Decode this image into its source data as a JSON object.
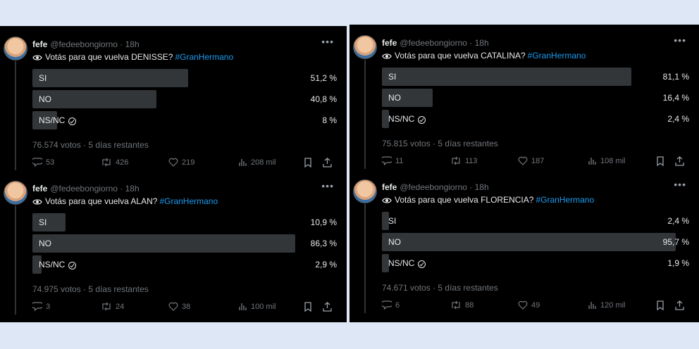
{
  "tweets": [
    {
      "user": {
        "name": "fefe",
        "handle": "@fedeebongiorno",
        "time": "18h"
      },
      "question": "Votás para que vuelva DENISSE?",
      "hashtag": "#GranHermano",
      "options": [
        {
          "label": "SI",
          "percent_text": "51,2 %",
          "percent": 51.2
        },
        {
          "label": "NO",
          "percent_text": "40,8 %",
          "percent": 40.8
        },
        {
          "label": "NS/NC",
          "percent_text": "8 %",
          "percent": 8,
          "selected": true
        }
      ],
      "votes_info": "76.574 votos · 5 días restantes",
      "stats": {
        "replies": "53",
        "retweets": "426",
        "likes": "219",
        "views": "208 mil"
      }
    },
    {
      "user": {
        "name": "fefe",
        "handle": "@fedeebongiorno",
        "time": "18h"
      },
      "question": "Votás para que vuelva ALAN?",
      "hashtag": "#GranHermano",
      "options": [
        {
          "label": "SI",
          "percent_text": "10,9 %",
          "percent": 10.9
        },
        {
          "label": "NO",
          "percent_text": "86,3 %",
          "percent": 86.3
        },
        {
          "label": "NS/NC",
          "percent_text": "2,9 %",
          "percent": 2.9,
          "selected": true
        }
      ],
      "votes_info": "74.975 votos · 5 días restantes",
      "stats": {
        "replies": "3",
        "retweets": "24",
        "likes": "38",
        "views": "100 mil"
      }
    },
    {
      "user": {
        "name": "fefe",
        "handle": "@fedeebongiorno",
        "time": "18h"
      },
      "question": "Votás para que vuelva CATALINA?",
      "hashtag": "#GranHermano",
      "options": [
        {
          "label": "SI",
          "percent_text": "81,1 %",
          "percent": 81.1
        },
        {
          "label": "NO",
          "percent_text": "16,4 %",
          "percent": 16.4
        },
        {
          "label": "NS/NC",
          "percent_text": "2,4 %",
          "percent": 2.4,
          "selected": true
        }
      ],
      "votes_info": "75.815 votos · 5 días restantes",
      "stats": {
        "replies": "11",
        "retweets": "113",
        "likes": "187",
        "views": "108 mil"
      }
    },
    {
      "user": {
        "name": "fefe",
        "handle": "@fedeebongiorno",
        "time": "18h"
      },
      "question": "Votás para que vuelva FLORENCIA?",
      "hashtag": "#GranHermano",
      "options": [
        {
          "label": "SI",
          "percent_text": "2,4 %",
          "percent": 2.4
        },
        {
          "label": "NO",
          "percent_text": "95,7 %",
          "percent": 95.7
        },
        {
          "label": "NS/NC",
          "percent_text": "1,9 %",
          "percent": 1.9,
          "selected": true
        }
      ],
      "votes_info": "74.671 votos · 5 días restantes",
      "stats": {
        "replies": "6",
        "retweets": "88",
        "likes": "49",
        "views": "120 mil"
      }
    }
  ],
  "colors": {
    "background": "#000000",
    "bar": "#333639",
    "text": "#e7e9ea",
    "muted": "#71767b",
    "accent": "#1d9bf0",
    "page": "#dde7f5"
  },
  "icons": [
    "eye-icon",
    "more-icon",
    "reply-icon",
    "retweet-icon",
    "like-icon",
    "views-icon",
    "bookmark-icon",
    "share-icon",
    "check-circle-icon"
  ]
}
